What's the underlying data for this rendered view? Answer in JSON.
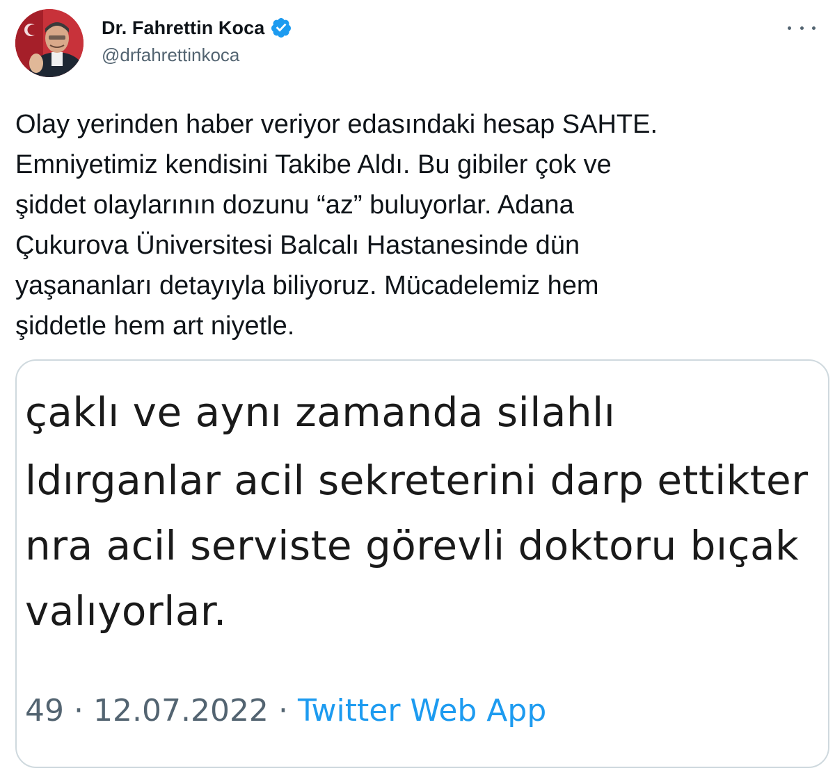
{
  "author": {
    "display_name": "Dr. Fahrettin Koca",
    "handle": "@drfahrettinkoca",
    "verified": true,
    "avatar_icon": "profile-photo-icon"
  },
  "tweet": {
    "text": "Olay yerinden haber veriyor edasındaki hesap SAHTE.\nEmniyetimiz kendisini Takibe Aldı. Bu gibiler çok ve\nşiddet olaylarının dozunu “az” buluyorlar. Adana\nÇukurova Üniversitesi Balcalı Hastanesinde dün\nyaşananları detayıyla biliyoruz. Mücadelemiz hem\nşiddetle hem art niyetle."
  },
  "quoted_image": {
    "lines": [
      "çaklı ve aynı zamanda silahlı",
      "ldırganlar acil sekreterini darp ettikter",
      "nra acil serviste görevli doktoru bıçak",
      "valıyorlar."
    ],
    "footer": {
      "time_fragment": "49",
      "separator": "·",
      "date": "12.07.2022",
      "source": "Twitter Web App"
    }
  },
  "colors": {
    "text_primary": "#0f1419",
    "text_secondary": "#536471",
    "accent": "#1d9bf0",
    "card_border": "#cfd9de"
  }
}
